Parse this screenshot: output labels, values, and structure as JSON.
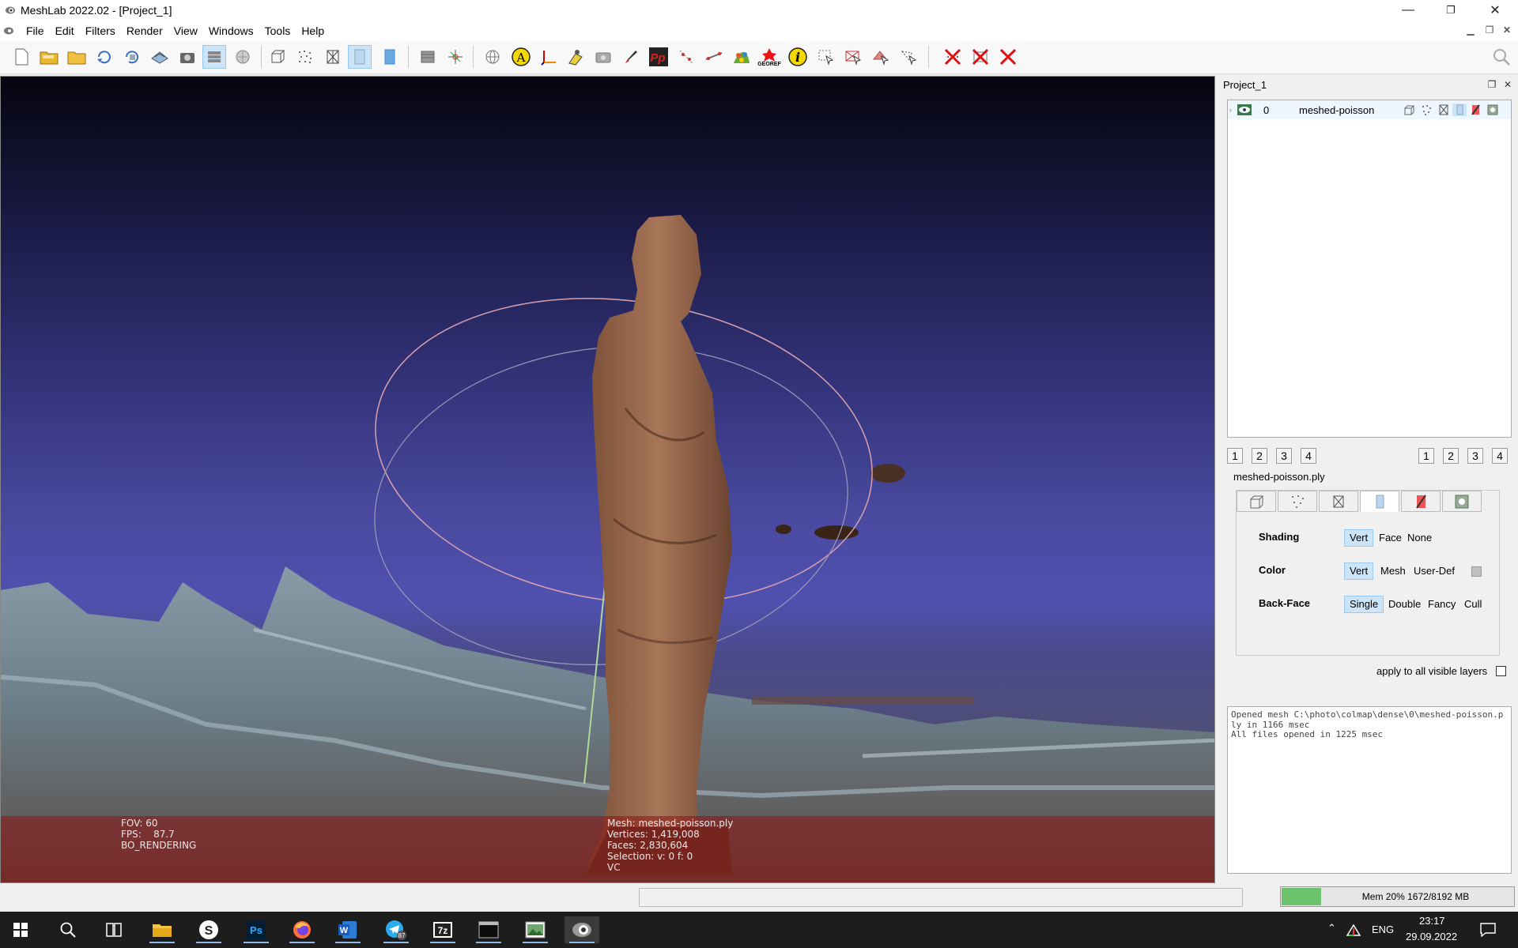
{
  "titlebar": {
    "title": "MeshLab 2022.02 - [Project_1]",
    "minimize_icon": "minimize-icon",
    "restore_icon": "restore-icon",
    "close_icon": "close-icon"
  },
  "menubar": {
    "items": [
      "File",
      "Edit",
      "Filters",
      "Render",
      "View",
      "Windows",
      "Tools",
      "Help"
    ]
  },
  "toolbar": {
    "groups": [
      [
        "new-project-icon",
        "open-project-icon",
        "import-mesh-icon",
        "reload-icon",
        "reload-all-icon",
        "export-mesh-icon",
        "snapshot-icon",
        "show-layers-icon",
        "raster-layers-icon"
      ],
      [
        "bounding-box-icon",
        "points-icon",
        "wireframe-icon",
        "flat-shading-icon",
        "smooth-shading-icon"
      ],
      [
        "fullscreen-icon",
        "trackball-axis-icon"
      ],
      [
        "sphere-icon",
        "annotation-icon",
        "axes-icon",
        "pick-color-icon",
        "camera-icon",
        "paint-icon",
        "pick-point-icon",
        "align-icon",
        "measure-icon",
        "paint-texture-icon",
        "georef-icon",
        "info-icon",
        "select-vertices-icon",
        "select-faces-icon",
        "select-connected-icon",
        "select-region-icon"
      ],
      [
        "delete-vertices-icon",
        "delete-faces-icon",
        "delete-faces-vertices-icon"
      ]
    ],
    "georef_label": "GEOREF",
    "info_glyph": "i",
    "annotation_glyph": "A",
    "pick_point_glyph": "Pp",
    "search_icon": "search-icon"
  },
  "viewport": {
    "fov_label": "FOV:",
    "fov_value": "60",
    "fps_label": "FPS:",
    "fps_value": "87.7",
    "render_mode": "BO_RENDERING",
    "mesh_line": "Mesh: meshed-poisson.ply",
    "vertices_line": "Vertices: 1,419,008",
    "faces_line": "Faces: 2,830,604",
    "selection_line": "Selection: v: 0 f: 0",
    "color_mode": "VC",
    "background_colors": {
      "top": "#050510",
      "bottom": "#5050b0"
    },
    "info_strip_color": "#8c1414"
  },
  "panel": {
    "title": "Project_1",
    "float_icon": "float-icon",
    "close_icon": "close-icon",
    "layers": [
      {
        "index": "0",
        "name": "meshed-poisson",
        "visible_icon": "eye-icon"
      }
    ],
    "snap_left": [
      "1",
      "2",
      "3",
      "4"
    ],
    "snap_right": [
      "1",
      "2",
      "3",
      "4"
    ],
    "mesh_group_title": "meshed-poisson.ply",
    "render_tabs": [
      "bbox-tab-icon",
      "points-tab-icon",
      "wire-tab-icon",
      "solid-tab-icon",
      "texture-tab-icon",
      "dots-tab-icon"
    ],
    "render_options": {
      "shading_label": "Shading",
      "shading_options": [
        "Vert",
        "Face",
        "None"
      ],
      "shading_selected": "Vert",
      "color_label": "Color",
      "color_options": [
        "Vert",
        "Mesh",
        "User-Def"
      ],
      "color_selected": "Vert",
      "backface_label": "Back-Face",
      "backface_options": [
        "Single",
        "Double",
        "Fancy",
        "Cull"
      ],
      "backface_selected": "Single"
    },
    "apply_all_label": "apply to all visible layers",
    "apply_all_checked": false,
    "log": "Opened mesh C:\\photo\\colmap\\dense\\0\\meshed-poisson.ply in 1166 msec\nAll files opened in 1225 msec"
  },
  "statusbar": {
    "mem_text": "Mem 20% 1672/8192 MB",
    "mem_fraction": 0.2,
    "mem_color": "#6cc36c"
  },
  "taskbar": {
    "apps": [
      "windows-start-icon",
      "search-icon",
      "task-view-icon",
      "file-explorer-icon",
      "s-app-icon",
      "photoshop-icon",
      "firefox-icon",
      "word-icon",
      "telegram-icon",
      "7zip-icon",
      "terminal-icon",
      "image-viewer-icon",
      "meshlab-icon"
    ],
    "telegram_badge": "87",
    "ps_label": "Ps",
    "word_label": "W",
    "zip_label": "7z",
    "s_label": "S",
    "lang": "ENG",
    "time": "23:17",
    "date": "29.09.2022"
  }
}
